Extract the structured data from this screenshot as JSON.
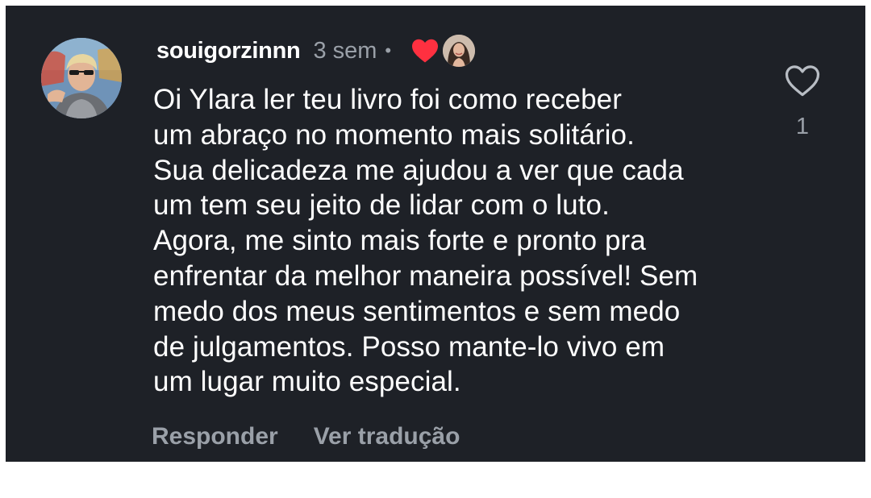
{
  "comment": {
    "username": "souigorzinnn",
    "time": "3 sem",
    "separator": "•",
    "text": "Oi Ylara ler teu livro foi como receber\num abraço no momento mais solitário.\nSua delicadeza me ajudou a ver que cada\num tem seu jeito de lidar com o luto.\nAgora, me sinto mais forte e pronto pra\nenfrentar da melhor maneira possível! Sem\nmedo dos meus sentimentos e sem medo\nde julgamentos. Posso mante-lo vivo em\num lugar muito especial.",
    "like_count": "1",
    "creator_liked_icon": "heart-filled-icon",
    "like_icon": "heart-outline-icon"
  },
  "actions": {
    "reply_label": "Responder",
    "translate_label": "Ver tradução"
  },
  "colors": {
    "background": "#1e2127",
    "text": "#ffffff",
    "muted": "#9aa0a8",
    "heart_red": "#ff3040"
  }
}
